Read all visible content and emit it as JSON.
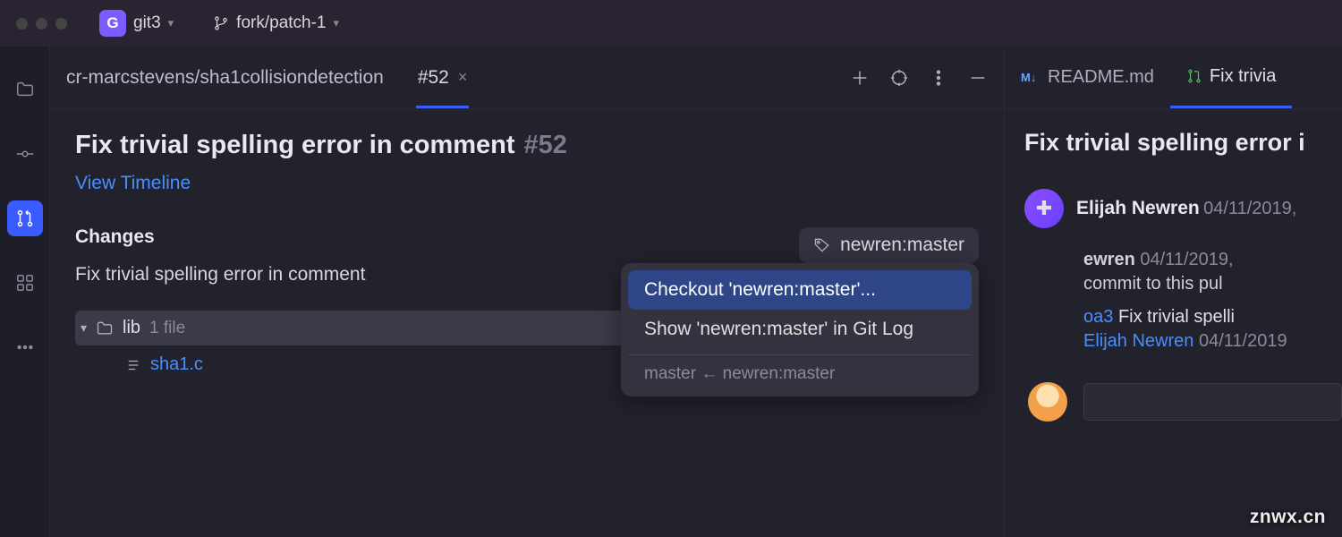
{
  "titlebar": {
    "project_abbrev": "G",
    "project_name": "git3",
    "branch_name": "fork/patch-1"
  },
  "activity": {
    "items": [
      "folder",
      "commit",
      "pr",
      "apps",
      "more"
    ]
  },
  "breadcrumb": "cr-marcstevens/sha1collisiondetection",
  "tab": {
    "label": "#52"
  },
  "pr": {
    "title": "Fix trivial spelling error in comment",
    "number": "#52",
    "timeline_link": "View Timeline",
    "changes_label": "Changes",
    "commit_message": "Fix trivial spelling error in comment",
    "branch_pill": "newren:master",
    "folder": {
      "name": "lib",
      "file_count": "1 file"
    },
    "file": "sha1.c"
  },
  "popup": {
    "item_checkout": "Checkout 'newren:master'...",
    "item_gitlog": "Show 'newren:master' in Git Log",
    "footer": "master ← newren:master"
  },
  "rightpanel": {
    "tab_readme": "README.md",
    "tab_fix": "Fix trivia",
    "title": "Fix trivial spelling error i",
    "author_name": "Elijah Newren",
    "author_date": "04/11/2019,",
    "meta_name": "ewren",
    "meta_date": "04/11/2019,",
    "meta_text": " commit to this pul",
    "commit_hash": "oa3",
    "commit_msg": "Fix trivial spelli",
    "commit_author_name": "Elijah Newren",
    "commit_author_date": "04/11/2019"
  },
  "watermark": "znwx.cn"
}
